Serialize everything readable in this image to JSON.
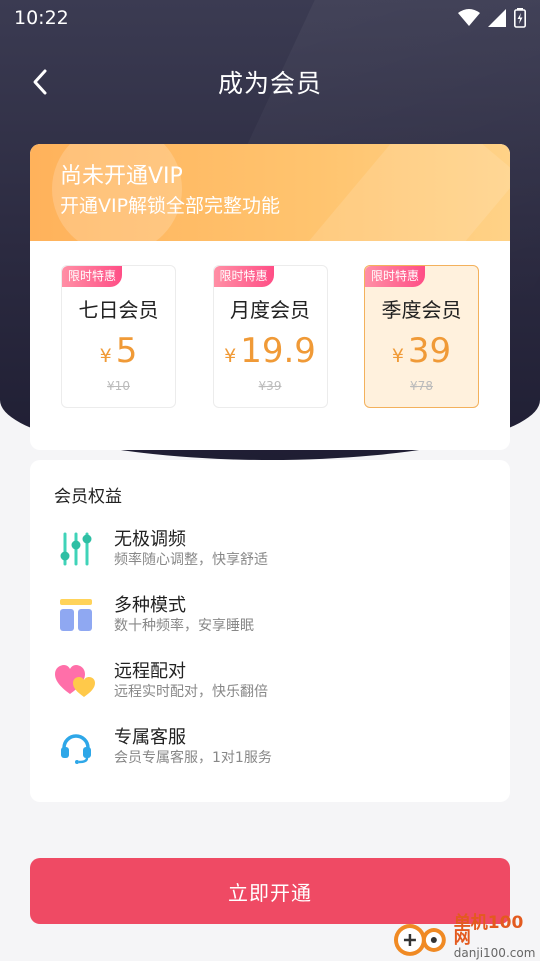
{
  "status_bar": {
    "time": "10:22"
  },
  "header": {
    "title": "成为会员"
  },
  "vip": {
    "title": "尚未开通VIP",
    "subtitle": "开通VIP解锁全部完整功能"
  },
  "plans": [
    {
      "badge": "限时特惠",
      "name": "七日会员",
      "currency": "¥",
      "price": "5",
      "original": "¥10",
      "selected": false
    },
    {
      "badge": "限时特惠",
      "name": "月度会员",
      "currency": "¥",
      "price": "19.9",
      "original": "¥39",
      "selected": false
    },
    {
      "badge": "限时特惠",
      "name": "季度会员",
      "currency": "¥",
      "price": "39",
      "original": "¥78",
      "selected": true
    }
  ],
  "benefits": {
    "title": "会员权益",
    "items": [
      {
        "icon": "sliders-icon",
        "name": "无极调频",
        "desc": "频率随心调整，快享舒适"
      },
      {
        "icon": "layout-icon",
        "name": "多种模式",
        "desc": "数十种频率，安享睡眠"
      },
      {
        "icon": "hearts-icon",
        "name": "远程配对",
        "desc": "远程实时配对，快乐翻倍"
      },
      {
        "icon": "headset-icon",
        "name": "专属客服",
        "desc": "会员专属客服，1对1服务"
      }
    ]
  },
  "cta": {
    "label": "立即开通"
  },
  "watermark": {
    "name": "单机100网",
    "url": "danji100.com"
  },
  "colors": {
    "accent": "#ef4a64",
    "price": "#f09a37",
    "gold": "#ffb25b"
  }
}
